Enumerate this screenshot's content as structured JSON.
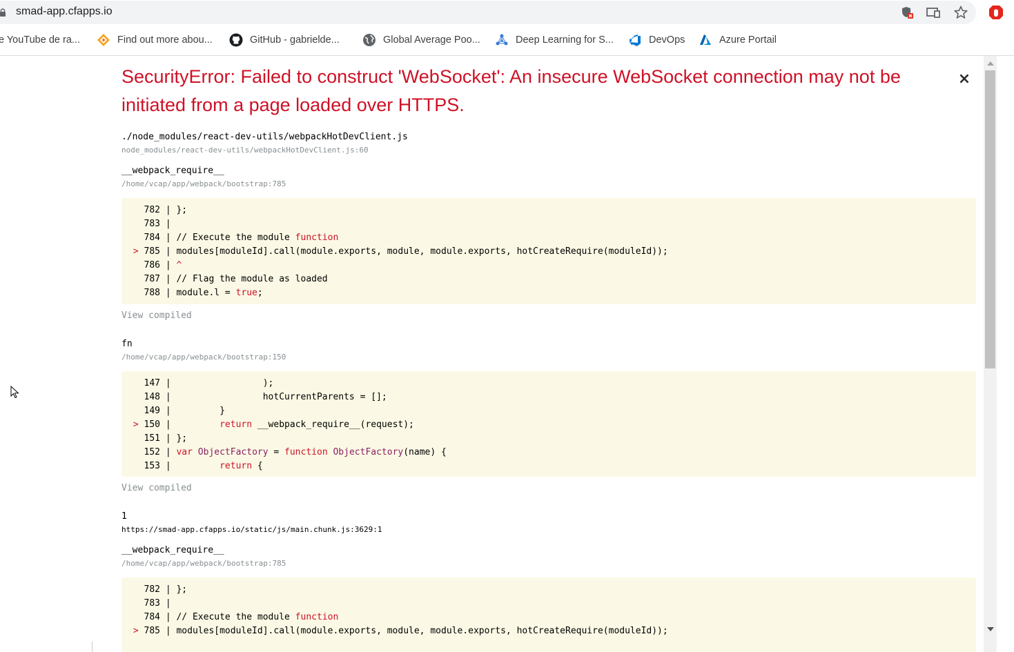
{
  "browser": {
    "url": "smad-app.cfapps.io",
    "bookmarks": [
      {
        "label": "e YouTube de ra...",
        "icon": "youtube-icon"
      },
      {
        "label": "Find out more abou...",
        "icon": "diamond-logo-icon"
      },
      {
        "label": "GitHub - gabrielde...",
        "icon": "github-icon"
      },
      {
        "label": "Global Average Poo...",
        "icon": "globe-icon"
      },
      {
        "label": "Deep Learning for S...",
        "icon": "network-logo-icon"
      },
      {
        "label": "DevOps",
        "icon": "devops-icon"
      },
      {
        "label": "Azure Portail",
        "icon": "azure-icon"
      }
    ]
  },
  "error": {
    "title": "SecurityError: Failed to construct 'WebSocket': An insecure WebSocket connection may not be initiated from a page loaded over HTTPS.",
    "close_label": "×",
    "view_compiled_label": "View compiled"
  },
  "frames": [
    {
      "name": "./node_modules/react-dev-utils/webpackHotDevClient.js",
      "location": "node_modules/react-dev-utils/webpackHotDevClient.js:60"
    },
    {
      "name": "__webpack_require__",
      "location": "/home/vcap/app/webpack/bootstrap:785"
    },
    {
      "name": "fn",
      "location": "/home/vcap/app/webpack/bootstrap:150"
    },
    {
      "name": "1",
      "location": "https://smad-app.cfapps.io/static/js/main.chunk.js:3629:1"
    },
    {
      "name": "__webpack_require__",
      "location": "/home/vcap/app/webpack/bootstrap:785"
    }
  ],
  "code_blocks": [
    {
      "lines": [
        {
          "num": "782",
          "code": " };"
        },
        {
          "num": "783",
          "code": ""
        },
        {
          "num": "784",
          "code": " // Execute the module function"
        },
        {
          "num": "785",
          "code": " modules[moduleId].call(module.exports, module, module.exports, hotCreateRequire(moduleId));",
          "marked": true
        },
        {
          "num": "786",
          "code": " ^"
        },
        {
          "num": "787",
          "code": " // Flag the module as loaded"
        },
        {
          "num": "788",
          "code": " module.l = true;"
        }
      ]
    },
    {
      "lines": [
        {
          "num": "147",
          "code": "                 );"
        },
        {
          "num": "148",
          "code": "                 hotCurrentParents = [];"
        },
        {
          "num": "149",
          "code": "         }"
        },
        {
          "num": "150",
          "code": "         return __webpack_require__(request);",
          "marked": true
        },
        {
          "num": "151",
          "code": " };"
        },
        {
          "num": "152",
          "code": " var ObjectFactory = function ObjectFactory(name) {"
        },
        {
          "num": "153",
          "code": "         return {"
        }
      ]
    },
    {
      "lines": [
        {
          "num": "782",
          "code": " };"
        },
        {
          "num": "783",
          "code": ""
        },
        {
          "num": "784",
          "code": " // Execute the module function"
        },
        {
          "num": "785",
          "code": " modules[moduleId].call(module.exports, module, module.exports, hotCreateRequire(moduleId));",
          "marked": true
        }
      ]
    }
  ],
  "colors": {
    "error_red": "#ce1126",
    "code_background": "#fbf9e5",
    "muted_gray": "#878e91"
  }
}
